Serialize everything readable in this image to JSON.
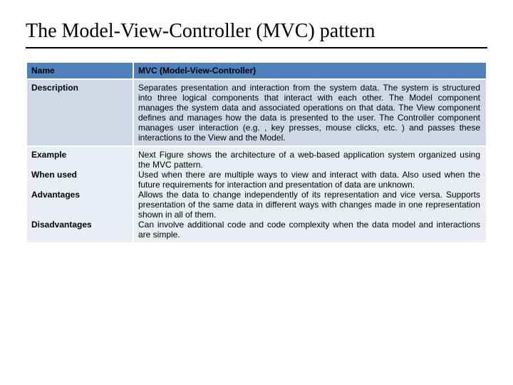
{
  "title": "The Model-View-Controller (MVC) pattern",
  "rows": {
    "name": {
      "label": "Name",
      "value": "MVC (Model-View-Controller)"
    },
    "description": {
      "label": "Description",
      "value": "Separates presentation and interaction from the system data. The system is structured into three logical components that interact with each other. The Model component manages the system data and associated operations on that data. The View component defines and manages how the data is presented to the user. The Controller component manages user interaction (e.g. , key presses, mouse clicks, etc. ) and passes these interactions to the View and the Model."
    },
    "example": {
      "label": "Example",
      "value": "Next Figure shows the architecture of a web-based application system organized using the MVC pattern."
    },
    "when_used": {
      "label": "When used",
      "value": "Used when there are multiple ways to view and interact with data. Also used when the future requirements for interaction and presentation of data are unknown."
    },
    "advantages": {
      "label": "Advantages",
      "value": "Allows the data to change independently of its representation and vice versa. Supports presentation of the same data in different ways with changes made in one representation shown in all of them."
    },
    "disadvantages": {
      "label": "Disadvantages",
      "value": "Can involve additional code and code complexity when the data model and interactions are simple."
    }
  }
}
